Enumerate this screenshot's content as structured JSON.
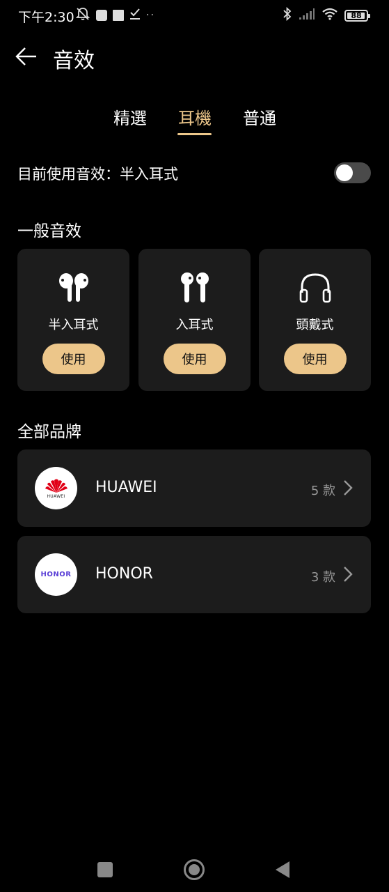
{
  "status_bar": {
    "time": "下午2:30",
    "battery": "88",
    "extra": "··"
  },
  "header": {
    "title": "音效"
  },
  "tabs": [
    {
      "label": "精選",
      "active": false
    },
    {
      "label": "耳機",
      "active": true
    },
    {
      "label": "普通",
      "active": false
    }
  ],
  "current": {
    "text": "目前使用音效：半入耳式",
    "toggle_on": false
  },
  "general": {
    "title": "一般音效",
    "cards": [
      {
        "label": "半入耳式",
        "icon": "semi-in-ear-earbuds-icon",
        "button": "使用"
      },
      {
        "label": "入耳式",
        "icon": "in-ear-earbuds-icon",
        "button": "使用"
      },
      {
        "label": "頭戴式",
        "icon": "headphones-icon",
        "button": "使用"
      }
    ]
  },
  "brands": {
    "title": "全部品牌",
    "items": [
      {
        "name": "HUAWEI",
        "count": "5 款",
        "logo_text": "HUAWEI",
        "logo_color": "#e10016"
      },
      {
        "name": "HONOR",
        "count": "3 款",
        "logo_text": "HONOR",
        "logo_color": "#5a3fd6"
      }
    ]
  },
  "colors": {
    "accent": "#ecc68a",
    "card_bg": "#1c1c1c",
    "background": "#000000"
  }
}
